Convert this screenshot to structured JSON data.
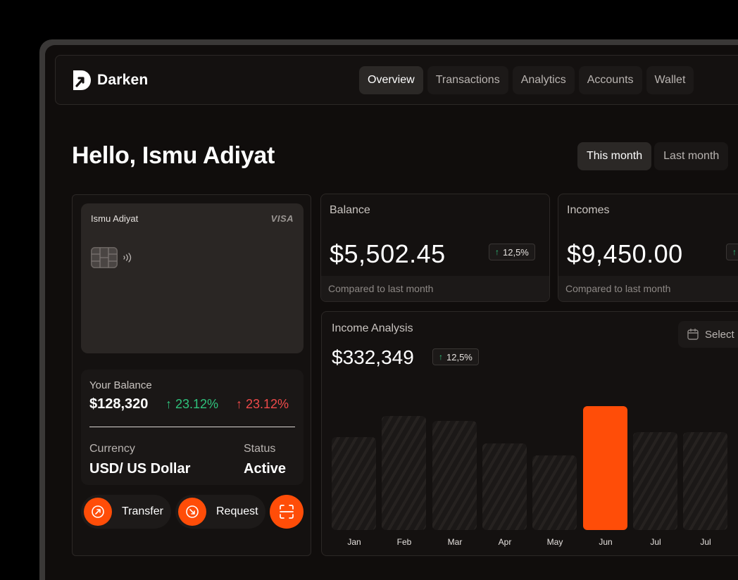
{
  "app": {
    "name": "Darken"
  },
  "nav": {
    "tabs": [
      {
        "label": "Overview",
        "active": true
      },
      {
        "label": "Transactions"
      },
      {
        "label": "Analytics"
      },
      {
        "label": "Accounts"
      },
      {
        "label": "Wallet"
      }
    ]
  },
  "greeting": "Hello, Ismu Adiyat",
  "period": {
    "this_month": "This month",
    "last_month": "Last month",
    "selected": "This month"
  },
  "card": {
    "holder": "Ismu Adiyat",
    "network": "VISA",
    "your_balance_label": "Your Balance",
    "your_balance_value": "$128,320",
    "change_up": "23.12%",
    "change_down": "23.12%",
    "currency_label": "Currency",
    "currency_value": "USD/ US Dollar",
    "status_label": "Status",
    "status_value": "Active"
  },
  "actions": {
    "transfer": "Transfer",
    "request": "Request"
  },
  "stats": {
    "balance": {
      "label": "Balance",
      "value": "$5,502.45",
      "change": "12,5%",
      "note": "Compared to last month"
    },
    "incomes": {
      "label": "Incomes",
      "value": "$9,450.00",
      "note": "Compared to last month"
    }
  },
  "income_analysis": {
    "title": "Income Analysis",
    "value": "$332,349",
    "change": "12,5%",
    "select_label": "Select"
  },
  "colors": {
    "accent": "#ff4d08",
    "positive": "#2fc27c",
    "negative": "#ef4a4a",
    "background": "#100d0c"
  },
  "chart_data": {
    "type": "bar",
    "categories": [
      "Jan",
      "Feb",
      "Mar",
      "Apr",
      "May",
      "Jun",
      "Jul",
      "Jul"
    ],
    "values": [
      0.75,
      0.92,
      0.88,
      0.7,
      0.6,
      1.0,
      0.79,
      0.79
    ],
    "highlighted": "Jun",
    "value_scale": "relative to tallest bar; no value axis shown",
    "grid": false
  }
}
